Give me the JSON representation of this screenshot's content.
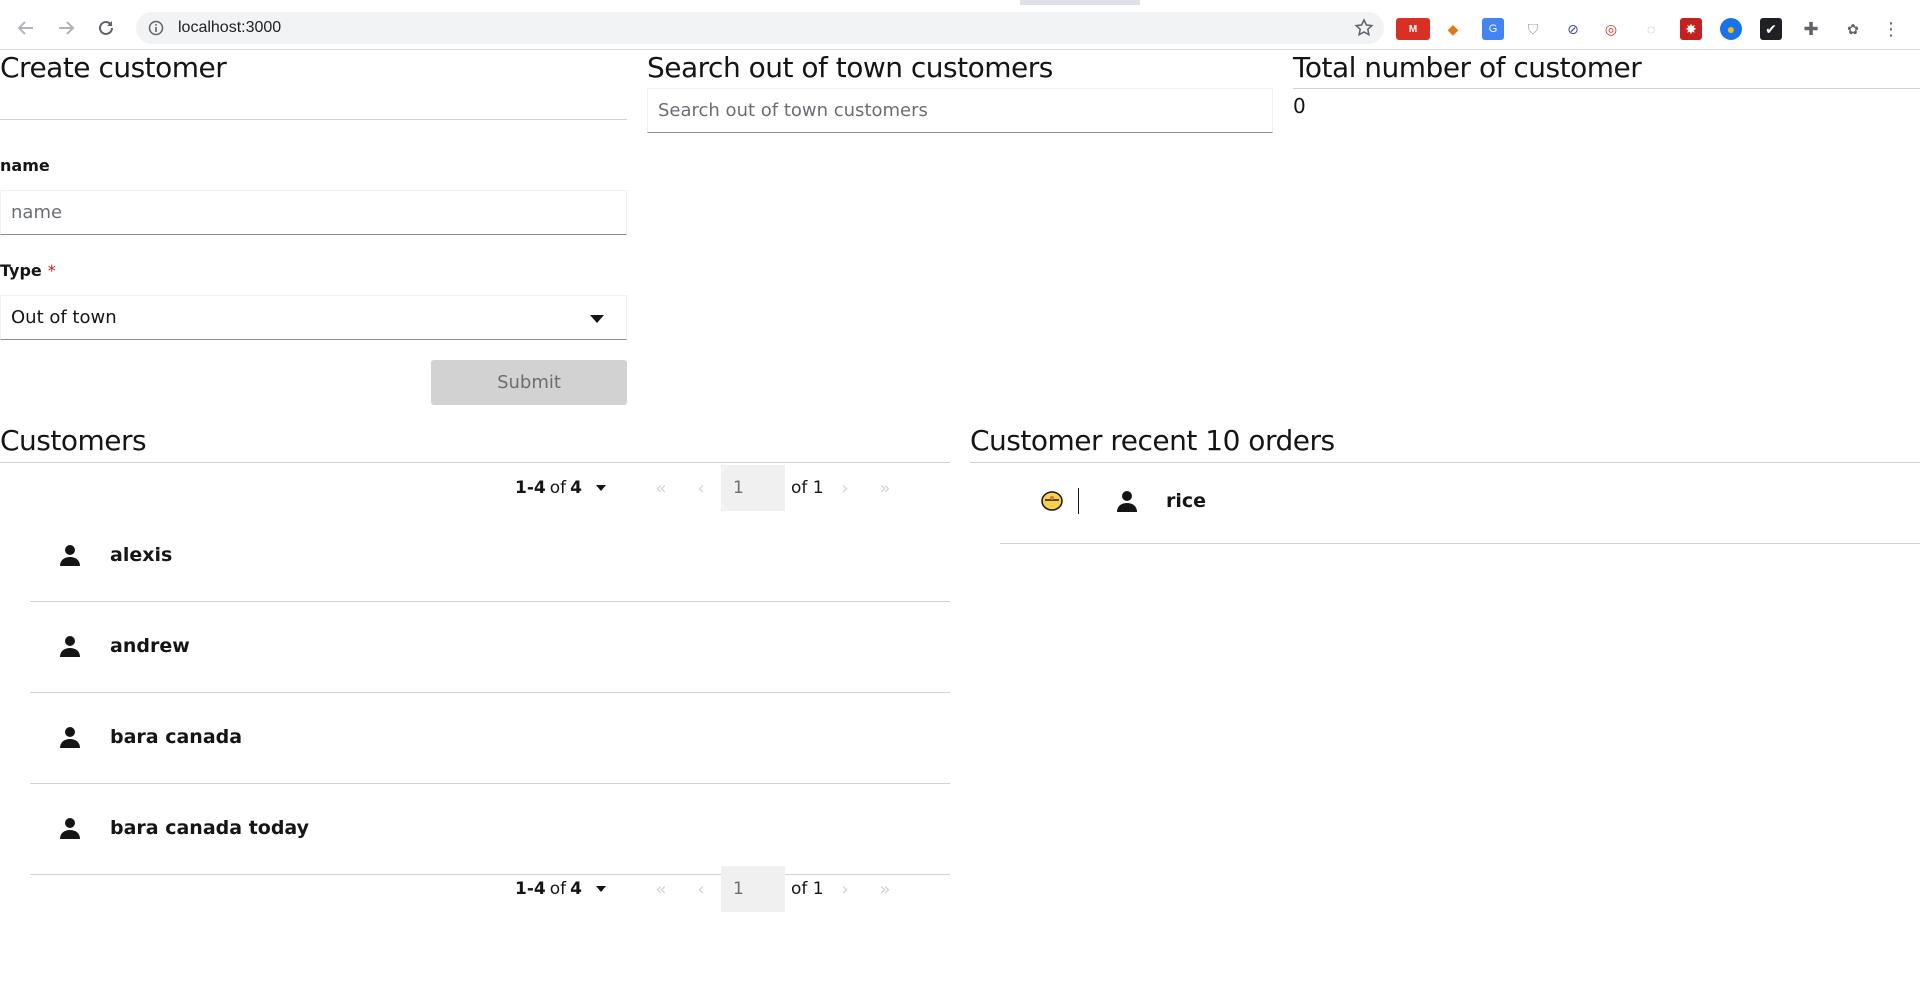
{
  "browser": {
    "url": "localhost:3000"
  },
  "create_customer": {
    "title": "Create customer",
    "name_label": "name",
    "name_placeholder": "name",
    "type_label": "Type",
    "required_mark": "*",
    "type_value": "Out of town",
    "submit_label": "Submit"
  },
  "search": {
    "title": "Search out of town customers",
    "placeholder": "Search out of town customers"
  },
  "total": {
    "title": "Total number of customer",
    "value": "0"
  },
  "customers": {
    "title": "Customers",
    "pagination": {
      "range_start": "1",
      "range_sep": " - ",
      "range_end": "4",
      "of_word": "of",
      "total": "4",
      "page": "1",
      "of_pages": "of 1"
    },
    "items": [
      {
        "name": "alexis"
      },
      {
        "name": "andrew"
      },
      {
        "name": "bara canada"
      },
      {
        "name": "bara canada today"
      }
    ]
  },
  "orders": {
    "title": "Customer recent 10 orders",
    "items": [
      {
        "name": "rice"
      }
    ]
  },
  "colors": {
    "accent": "#151515",
    "border": "#d2d2d2",
    "disabled": "#d2d2d2"
  }
}
